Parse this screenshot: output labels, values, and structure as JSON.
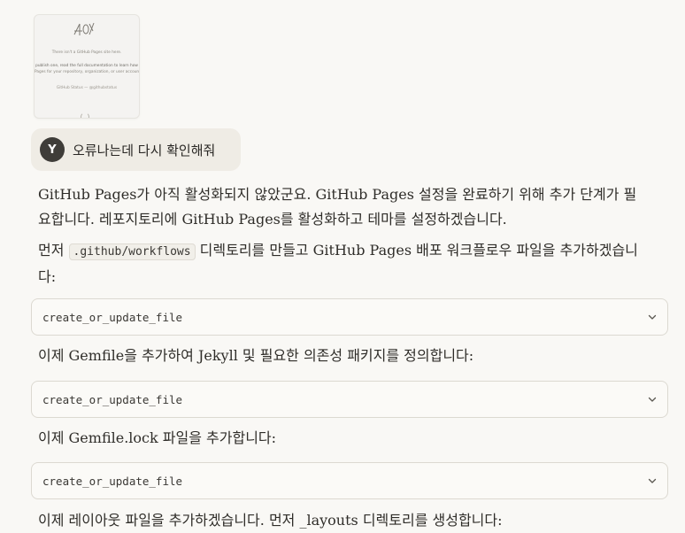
{
  "thumbnail": {
    "line1": "There isn't a GitHub Pages site here.",
    "line2": "publish one, read the full documentation to learn how",
    "line3": "Pages for your repository, organization, or user account.",
    "line4": "GitHub Status — @githubstatus"
  },
  "user_message": {
    "avatar_initial": "Y",
    "text": "오류나는데 다시 확인해줘"
  },
  "assistant": {
    "p1": "GitHub Pages가 아직 활성화되지 않았군요. GitHub Pages 설정을 완료하기 위해 추가 단계가 필요합니다. 레포지토리에 GitHub Pages를 활성화하고 테마를 설정하겠습니다.",
    "p2_before": "먼저 ",
    "p2_code": ".github/workflows",
    "p2_after": " 디렉토리를 만들고 GitHub Pages 배포 워크플로우 파일을 추가하겠습니다:",
    "p3": "이제 Gemfile을 추가하여 Jekyll 및 필요한 의존성 패키지를 정의합니다:",
    "p4": "이제 Gemfile.lock 파일을 추가합니다:",
    "p5": "이제 레이아웃 파일을 추가하겠습니다. 먼저 _layouts 디렉토리를 생성합니다:"
  },
  "tool_calls": [
    {
      "label": "create_or_update_file"
    },
    {
      "label": "create_or_update_file"
    },
    {
      "label": "create_or_update_file"
    }
  ],
  "icons": {
    "chevron": "chevron-down-icon"
  }
}
